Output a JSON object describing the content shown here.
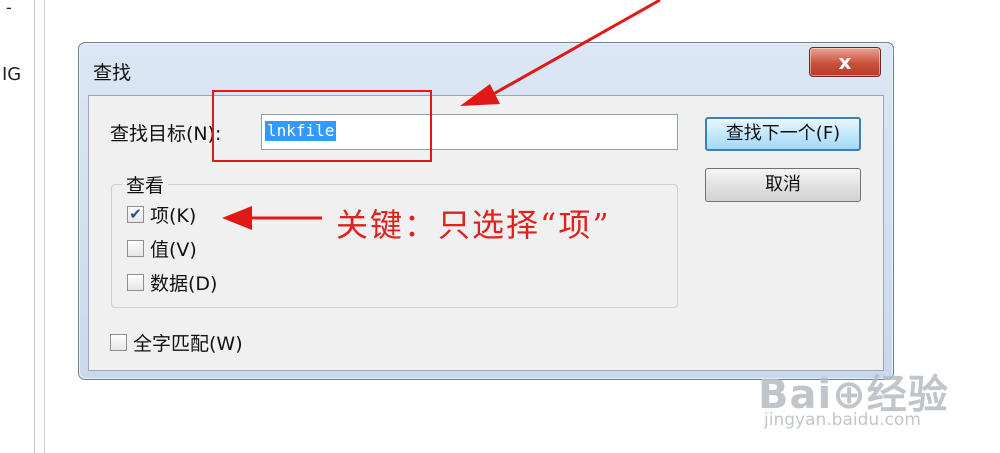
{
  "background": {
    "left_fragment": "IG",
    "left_dash": "-"
  },
  "dialog": {
    "title": "查找",
    "close_glyph": "x",
    "find_label": "查找目标(N):",
    "find_value": "lnkfile",
    "find_next_label": "查找下一个(F)",
    "cancel_label": "取消",
    "look_at_legend": "查看",
    "options": [
      {
        "label": "项(K)",
        "checked": true
      },
      {
        "label": "值(V)",
        "checked": false
      },
      {
        "label": "数据(D)",
        "checked": false
      }
    ],
    "whole_string_label": "全字匹配(W)",
    "whole_string_checked": false
  },
  "annotation": {
    "text": "关键：只选择“项”",
    "color": "#e0221f"
  },
  "watermark": {
    "brand": "Bai⊕经验",
    "site": "jingyan.baidu.com"
  }
}
